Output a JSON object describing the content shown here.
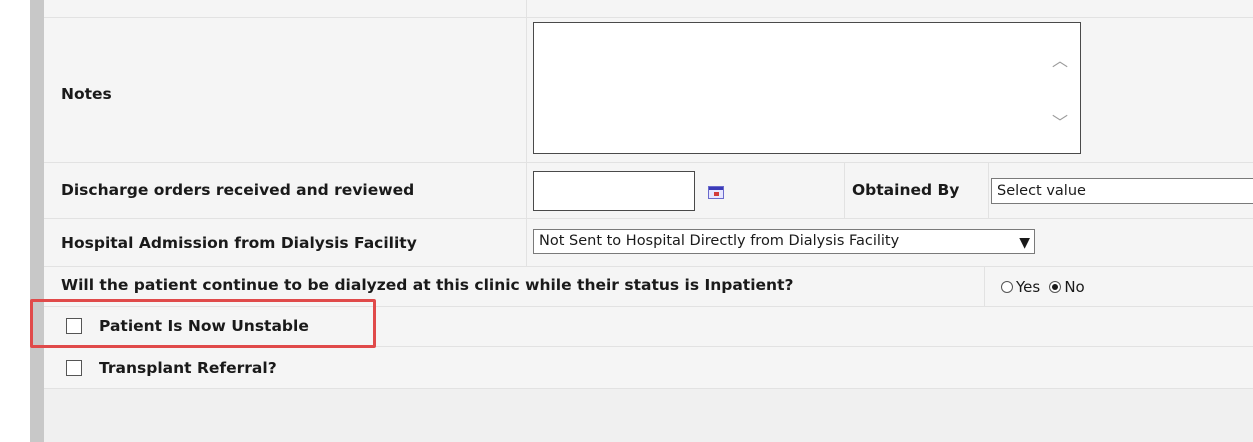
{
  "notes": {
    "label": "Notes",
    "value": ""
  },
  "discharge": {
    "label": "Discharge orders received and reviewed",
    "date_value": "",
    "calendar_icon": "calendar-icon",
    "obtained_by_label": "Obtained By",
    "obtained_by_value": "Select value"
  },
  "admission": {
    "label": "Hospital Admission from Dialysis Facility",
    "selected": "Not Sent to Hospital Directly from Dialysis Facility"
  },
  "inpatient": {
    "question": "Will the patient continue to be dialyzed at this clinic while their status is Inpatient?",
    "options": [
      "Yes",
      "No"
    ],
    "selected": "No"
  },
  "checks": {
    "unstable": {
      "label": "Patient Is Now Unstable",
      "checked": false
    },
    "transplant": {
      "label": "Transplant Referral?",
      "checked": false
    }
  },
  "highlight_color": "#e04a4a"
}
